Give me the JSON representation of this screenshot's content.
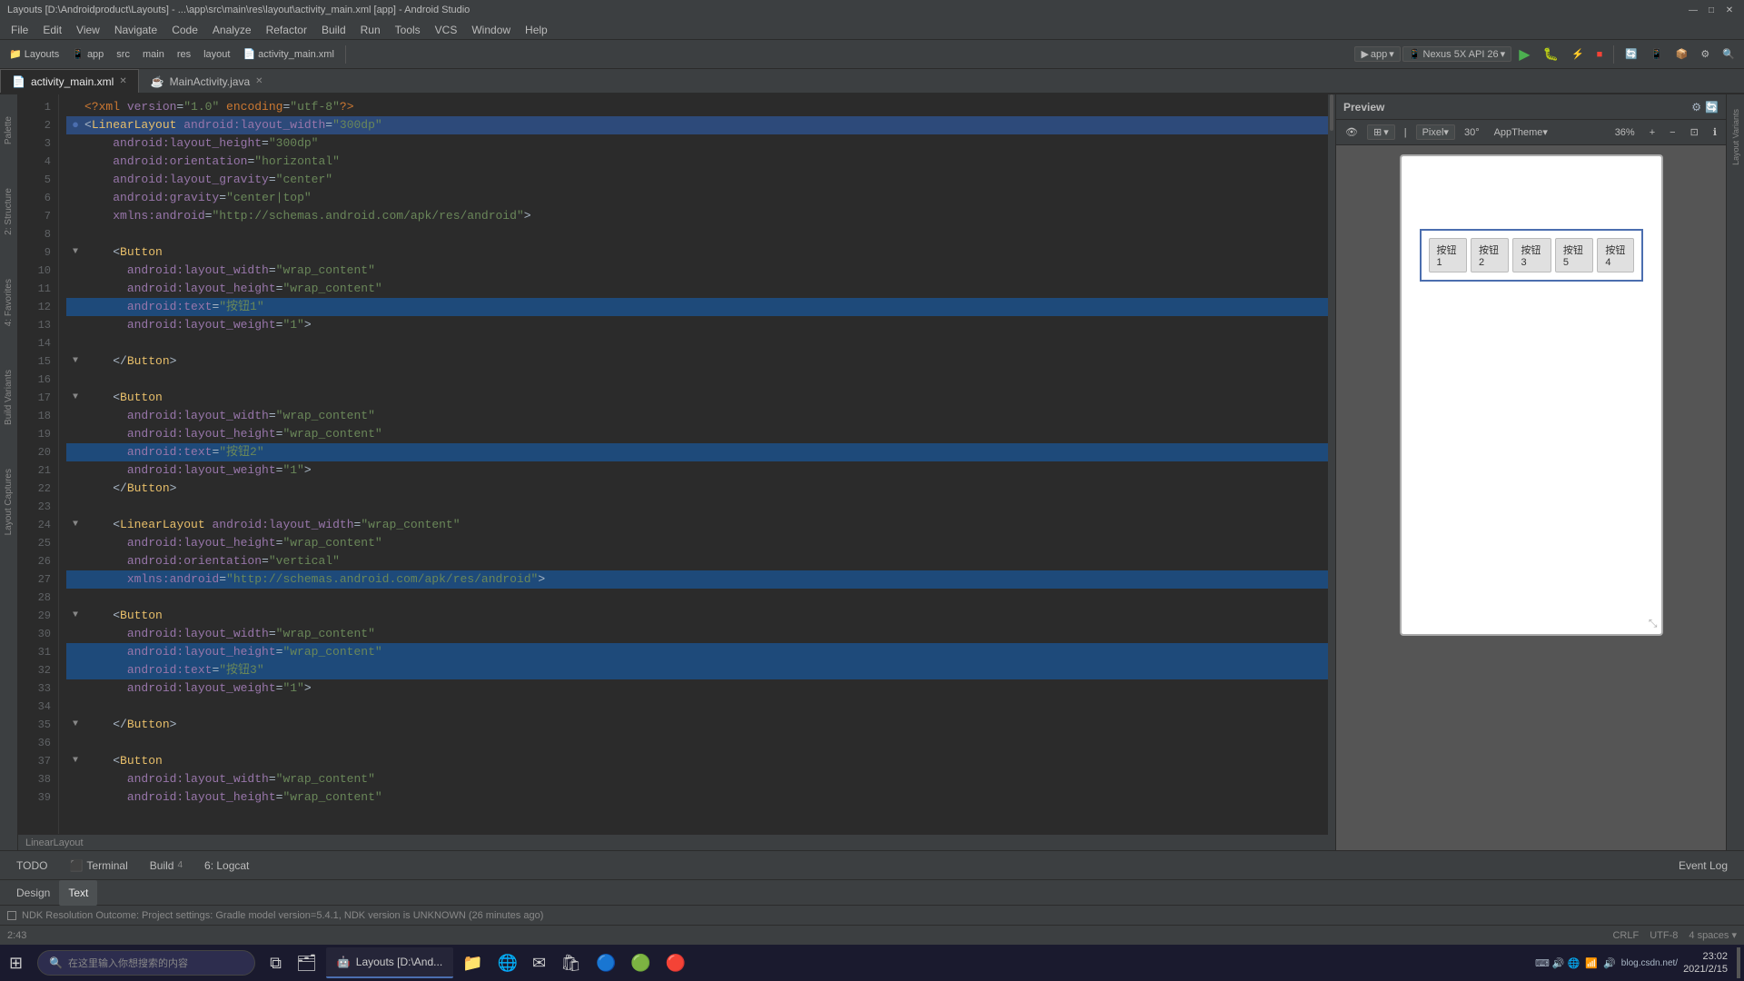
{
  "title_bar": {
    "title": "Layouts [D:\\Androidproduct\\Layouts] - ...\\app\\src\\main\\res\\layout\\activity_main.xml [app] - Android Studio",
    "minimize": "—",
    "maximize": "□",
    "close": "✕"
  },
  "menu": {
    "items": [
      "File",
      "Edit",
      "View",
      "Navigate",
      "Code",
      "Analyze",
      "Refactor",
      "Build",
      "Run",
      "Tools",
      "VCS",
      "Window",
      "Help"
    ]
  },
  "toolbar": {
    "breadcrumbs": [
      "Layouts",
      "app",
      "src",
      "main",
      "res",
      "layout",
      "activity_main.xml"
    ],
    "app_label": "app",
    "device_label": "Nexus 5X API 26",
    "zoom_label": "36%",
    "theme_label": "AppTheme▾"
  },
  "tabs": [
    {
      "label": "activity_main.xml",
      "active": true,
      "icon": "xml-icon"
    },
    {
      "label": "MainActivity.java",
      "active": false,
      "icon": "java-icon"
    }
  ],
  "code": {
    "lines": [
      {
        "num": "1",
        "content": "<?xml version=\"1.0\" encoding=\"utf-8\"?>",
        "type": "decl"
      },
      {
        "num": "2",
        "content": "  <LinearLayout android:layout_width=\"300dp\"",
        "type": "tag",
        "highlight": true,
        "has_dot": true
      },
      {
        "num": "3",
        "content": "    android:layout_height=\"300dp\"",
        "type": "attr"
      },
      {
        "num": "4",
        "content": "    android:orientation=\"horizontal\"",
        "type": "attr"
      },
      {
        "num": "5",
        "content": "    android:layout_gravity=\"center\"",
        "type": "attr"
      },
      {
        "num": "6",
        "content": "    android:gravity=\"center|top\"",
        "type": "attr"
      },
      {
        "num": "7",
        "content": "    xmlns:android=\"http://schemas.android.com/apk/res/android\">",
        "type": "attr"
      },
      {
        "num": "8",
        "content": "",
        "type": "empty"
      },
      {
        "num": "9",
        "content": "    <Button",
        "type": "tag",
        "has_fold": true
      },
      {
        "num": "10",
        "content": "      android:layout_width=\"wrap_content\"",
        "type": "attr"
      },
      {
        "num": "11",
        "content": "      android:layout_height=\"wrap_content\"",
        "type": "attr"
      },
      {
        "num": "12",
        "content": "      android:text=\"按钮1\"",
        "type": "attr",
        "selected": true
      },
      {
        "num": "13",
        "content": "      android:layout_weight=\"1\">",
        "type": "attr"
      },
      {
        "num": "14",
        "content": "",
        "type": "empty"
      },
      {
        "num": "15",
        "content": "    </Button>",
        "type": "tag",
        "has_fold": true
      },
      {
        "num": "16",
        "content": "",
        "type": "empty"
      },
      {
        "num": "17",
        "content": "    <Button",
        "type": "tag",
        "has_fold": true
      },
      {
        "num": "18",
        "content": "      android:layout_width=\"wrap_content\"",
        "type": "attr"
      },
      {
        "num": "19",
        "content": "      android:layout_height=\"wrap_content\"",
        "type": "attr"
      },
      {
        "num": "20",
        "content": "      android:text=\"按钮2\"",
        "type": "attr",
        "selected": true
      },
      {
        "num": "21",
        "content": "      android:layout_weight=\"1\">",
        "type": "attr"
      },
      {
        "num": "22",
        "content": "    </Button>",
        "type": "tag"
      },
      {
        "num": "23",
        "content": "",
        "type": "empty"
      },
      {
        "num": "24",
        "content": "    <LinearLayout android:layout_width=\"wrap_content\"",
        "type": "tag",
        "has_fold": true
      },
      {
        "num": "25",
        "content": "      android:layout_height=\"wrap_content\"",
        "type": "attr"
      },
      {
        "num": "26",
        "content": "      android:orientation=\"vertical\"",
        "type": "attr"
      },
      {
        "num": "27",
        "content": "      xmlns:android=\"http://schemas.android.com/apk/res/android\">",
        "type": "attr",
        "selected": true
      },
      {
        "num": "28",
        "content": "",
        "type": "empty"
      },
      {
        "num": "29",
        "content": "    <Button",
        "type": "tag",
        "has_fold": true
      },
      {
        "num": "30",
        "content": "      android:layout_width=\"wrap_content\"",
        "type": "attr"
      },
      {
        "num": "31",
        "content": "      android:layout_height=\"wrap_content\"",
        "type": "attr",
        "selected": true
      },
      {
        "num": "32",
        "content": "      android:text=\"按钮3\"",
        "type": "attr",
        "selected": true
      },
      {
        "num": "33",
        "content": "      android:layout_weight=\"1\">",
        "type": "attr"
      },
      {
        "num": "34",
        "content": "",
        "type": "empty"
      },
      {
        "num": "35",
        "content": "    </Button>",
        "type": "tag",
        "has_fold": true
      },
      {
        "num": "36",
        "content": "",
        "type": "empty"
      },
      {
        "num": "37",
        "content": "    <Button",
        "type": "tag",
        "has_fold": true
      },
      {
        "num": "38",
        "content": "      android:layout_width=\"wrap_content\"",
        "type": "attr"
      },
      {
        "num": "39",
        "content": "      android:layout_height=\"wrap_content\"",
        "type": "attr"
      }
    ]
  },
  "current_element": "LinearLayout",
  "preview": {
    "title": "Preview",
    "device": "Pixel▾",
    "orientation": "30°",
    "theme": "AppTheme▾",
    "zoom": "36%",
    "buttons": {
      "row1": [
        "按钮1",
        "按钮2",
        "按钮3",
        "按钮5"
      ],
      "row2": [
        "按钮4"
      ]
    }
  },
  "bottom_tabs": [
    {
      "label": "Design",
      "active": false
    },
    {
      "label": "Text",
      "active": true
    }
  ],
  "tool_tabs": [
    {
      "label": "TODO"
    },
    {
      "label": "Terminal"
    },
    {
      "label": "Build",
      "number": "4"
    },
    {
      "label": "6: Logcat"
    }
  ],
  "status": {
    "ndk_message": "NDK Resolution Outcome: Project settings: Gradle model version=5.4.1, NDK version is UNKNOWN (26 minutes ago)",
    "cursor": "2:43",
    "line_sep": "CRLF",
    "encoding": "UTF-8",
    "indent": "4 spaces ▾"
  },
  "event_log": "Event Log",
  "vertical_tabs_left": [
    "Palette",
    "2: Structure",
    "4: Favorites",
    "Build Variants",
    "Layout Captures"
  ],
  "vertical_tabs_right": [
    "Layout Variants"
  ],
  "taskbar": {
    "search_placeholder": "在这里输入你想搜索的内容",
    "time": "23:02",
    "date": "2021/2/15",
    "apps": [
      "🪟",
      "⊞",
      "📁",
      "🌐",
      "📧",
      "🔵",
      "🟢",
      "🔴"
    ],
    "android_studio_label": "Layouts [D:\\And..."
  }
}
